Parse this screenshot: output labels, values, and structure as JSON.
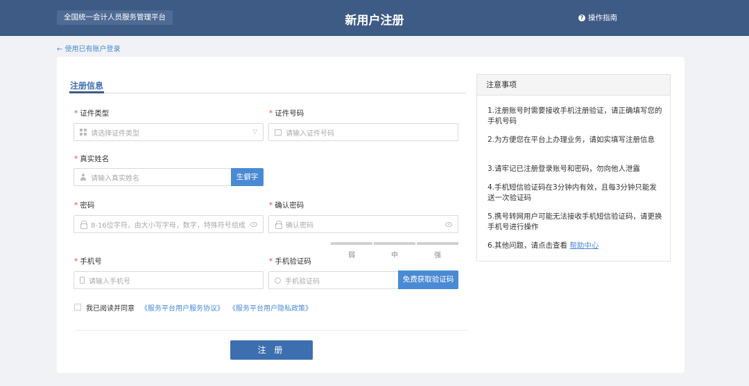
{
  "header": {
    "platform_name": "全国统一会计人员服务管理平台",
    "page_title": "新用户注册",
    "guide_label": "操作指南",
    "guide_icon": "question-circle-icon"
  },
  "back_link": "← 使用已有账户登录",
  "form": {
    "tab_title": "注册信息",
    "required_mark": "*",
    "id_type": {
      "label": "证件类型",
      "placeholder": "请选择证件类型",
      "value": ""
    },
    "id_number": {
      "label": "证件号码",
      "placeholder": "请输入证件号码",
      "value": ""
    },
    "real_name": {
      "label": "真实姓名",
      "placeholder": "请输入真实姓名",
      "value": "",
      "button": "生僻字"
    },
    "password": {
      "label": "密码",
      "placeholder": "8-16位字符，由大小写字母，数字，特殊符号组成",
      "value": ""
    },
    "confirm_password": {
      "label": "确认密码",
      "placeholder": "确认密码",
      "value": ""
    },
    "strength_levels": [
      "弱",
      "中",
      "强"
    ],
    "phone": {
      "label": "手机号",
      "placeholder": "请输入手机号",
      "value": ""
    },
    "sms_code": {
      "label": "手机验证码",
      "placeholder": "手机验证码",
      "value": "",
      "button": "免费获取验证码"
    },
    "agreement": {
      "prefix": "我已阅读并同意",
      "service_link": "《服务平台用户服务协议》",
      "privacy_link": "《服务平台用户隐私政策》",
      "checked": false
    },
    "submit_label": "注 册"
  },
  "notes": {
    "title": "注意事项",
    "items": [
      "1.注册账号时需要接收手机注册验证，请正确填写您的手机号码",
      "2.为方便您在平台上办理业务，请如实填写注册信息",
      "3.请牢记已注册登录账号和密码，勿向他人泄露",
      "4.手机短信验证码在3分钟内有效，且每3分钟只能发送一次验证码",
      "5.携号转网用户可能无法接收手机短信验证码，请更换手机号进行操作"
    ],
    "last_item_prefix": "6.其他问题，请点击查看",
    "help_link": "帮助中心"
  },
  "colors": {
    "header_bg": "#3d5b85",
    "accent_blue": "#4a8ad4",
    "submit_bg": "#3d6fb0",
    "required_red": "#e0463c"
  }
}
